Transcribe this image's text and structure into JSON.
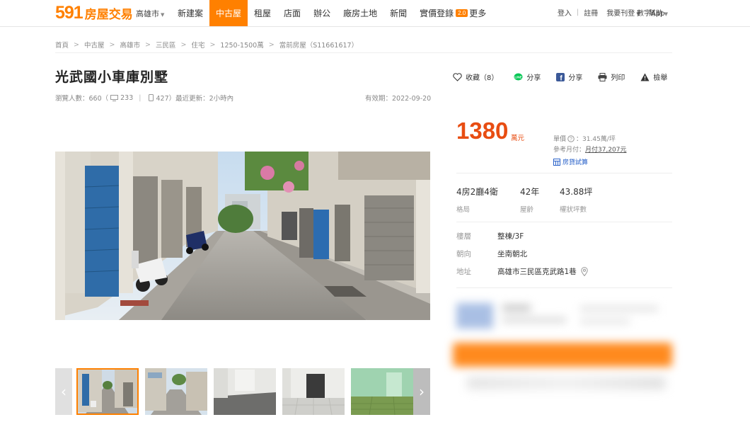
{
  "nav": {
    "logo_num": "591",
    "logo_text": "房屋交易",
    "city": "高雄市",
    "links": [
      "新建案",
      "中古屋",
      "租屋",
      "店面",
      "辦公",
      "廠房土地",
      "新聞",
      "實價登錄"
    ],
    "more_badge": "2.0",
    "more": "更多",
    "login": "登入",
    "register": "註冊",
    "post": "我要刊登",
    "help": "幫助",
    "app": "數字App"
  },
  "breadcrumb": [
    "首頁",
    "中古屋",
    "高雄市",
    "三民區",
    "住宅",
    "1250-1500萬",
    "當前房屋（S11661617）"
  ],
  "listing": {
    "title": "光武國小車庫別墅",
    "views_label": "瀏覽人數：660（",
    "views_pc": "233",
    "views_mobile": "427）最近更新：2小時內",
    "expiry": "有效期：2022-09-20"
  },
  "actions": {
    "favorite": "收藏（8）",
    "line_share": "分享",
    "fb_share": "分享",
    "print": "列印",
    "report": "檢舉"
  },
  "price": {
    "value": "1380",
    "unit": "萬元",
    "unit_price_label": "單價",
    "unit_price": "31.45萬/坪",
    "monthly_label": "參考月付：",
    "monthly": "月付37,207元",
    "loan": "房貸試算"
  },
  "specs": [
    {
      "value": "4房2廳4衛",
      "label": "格局"
    },
    {
      "value": "42年",
      "label": "屋齡"
    },
    {
      "value": "43.88坪",
      "label": "權狀坪數"
    }
  ],
  "details": [
    {
      "label": "樓層",
      "value": "整棟/3F"
    },
    {
      "label": "朝向",
      "value": "坐南朝北"
    },
    {
      "label": "地址",
      "value": "高雄市三民區克武路1巷"
    }
  ],
  "colors": {
    "accent": "#ff8000",
    "price": "#e84d12",
    "link": "#2a62c9"
  },
  "thumbnails": 5
}
